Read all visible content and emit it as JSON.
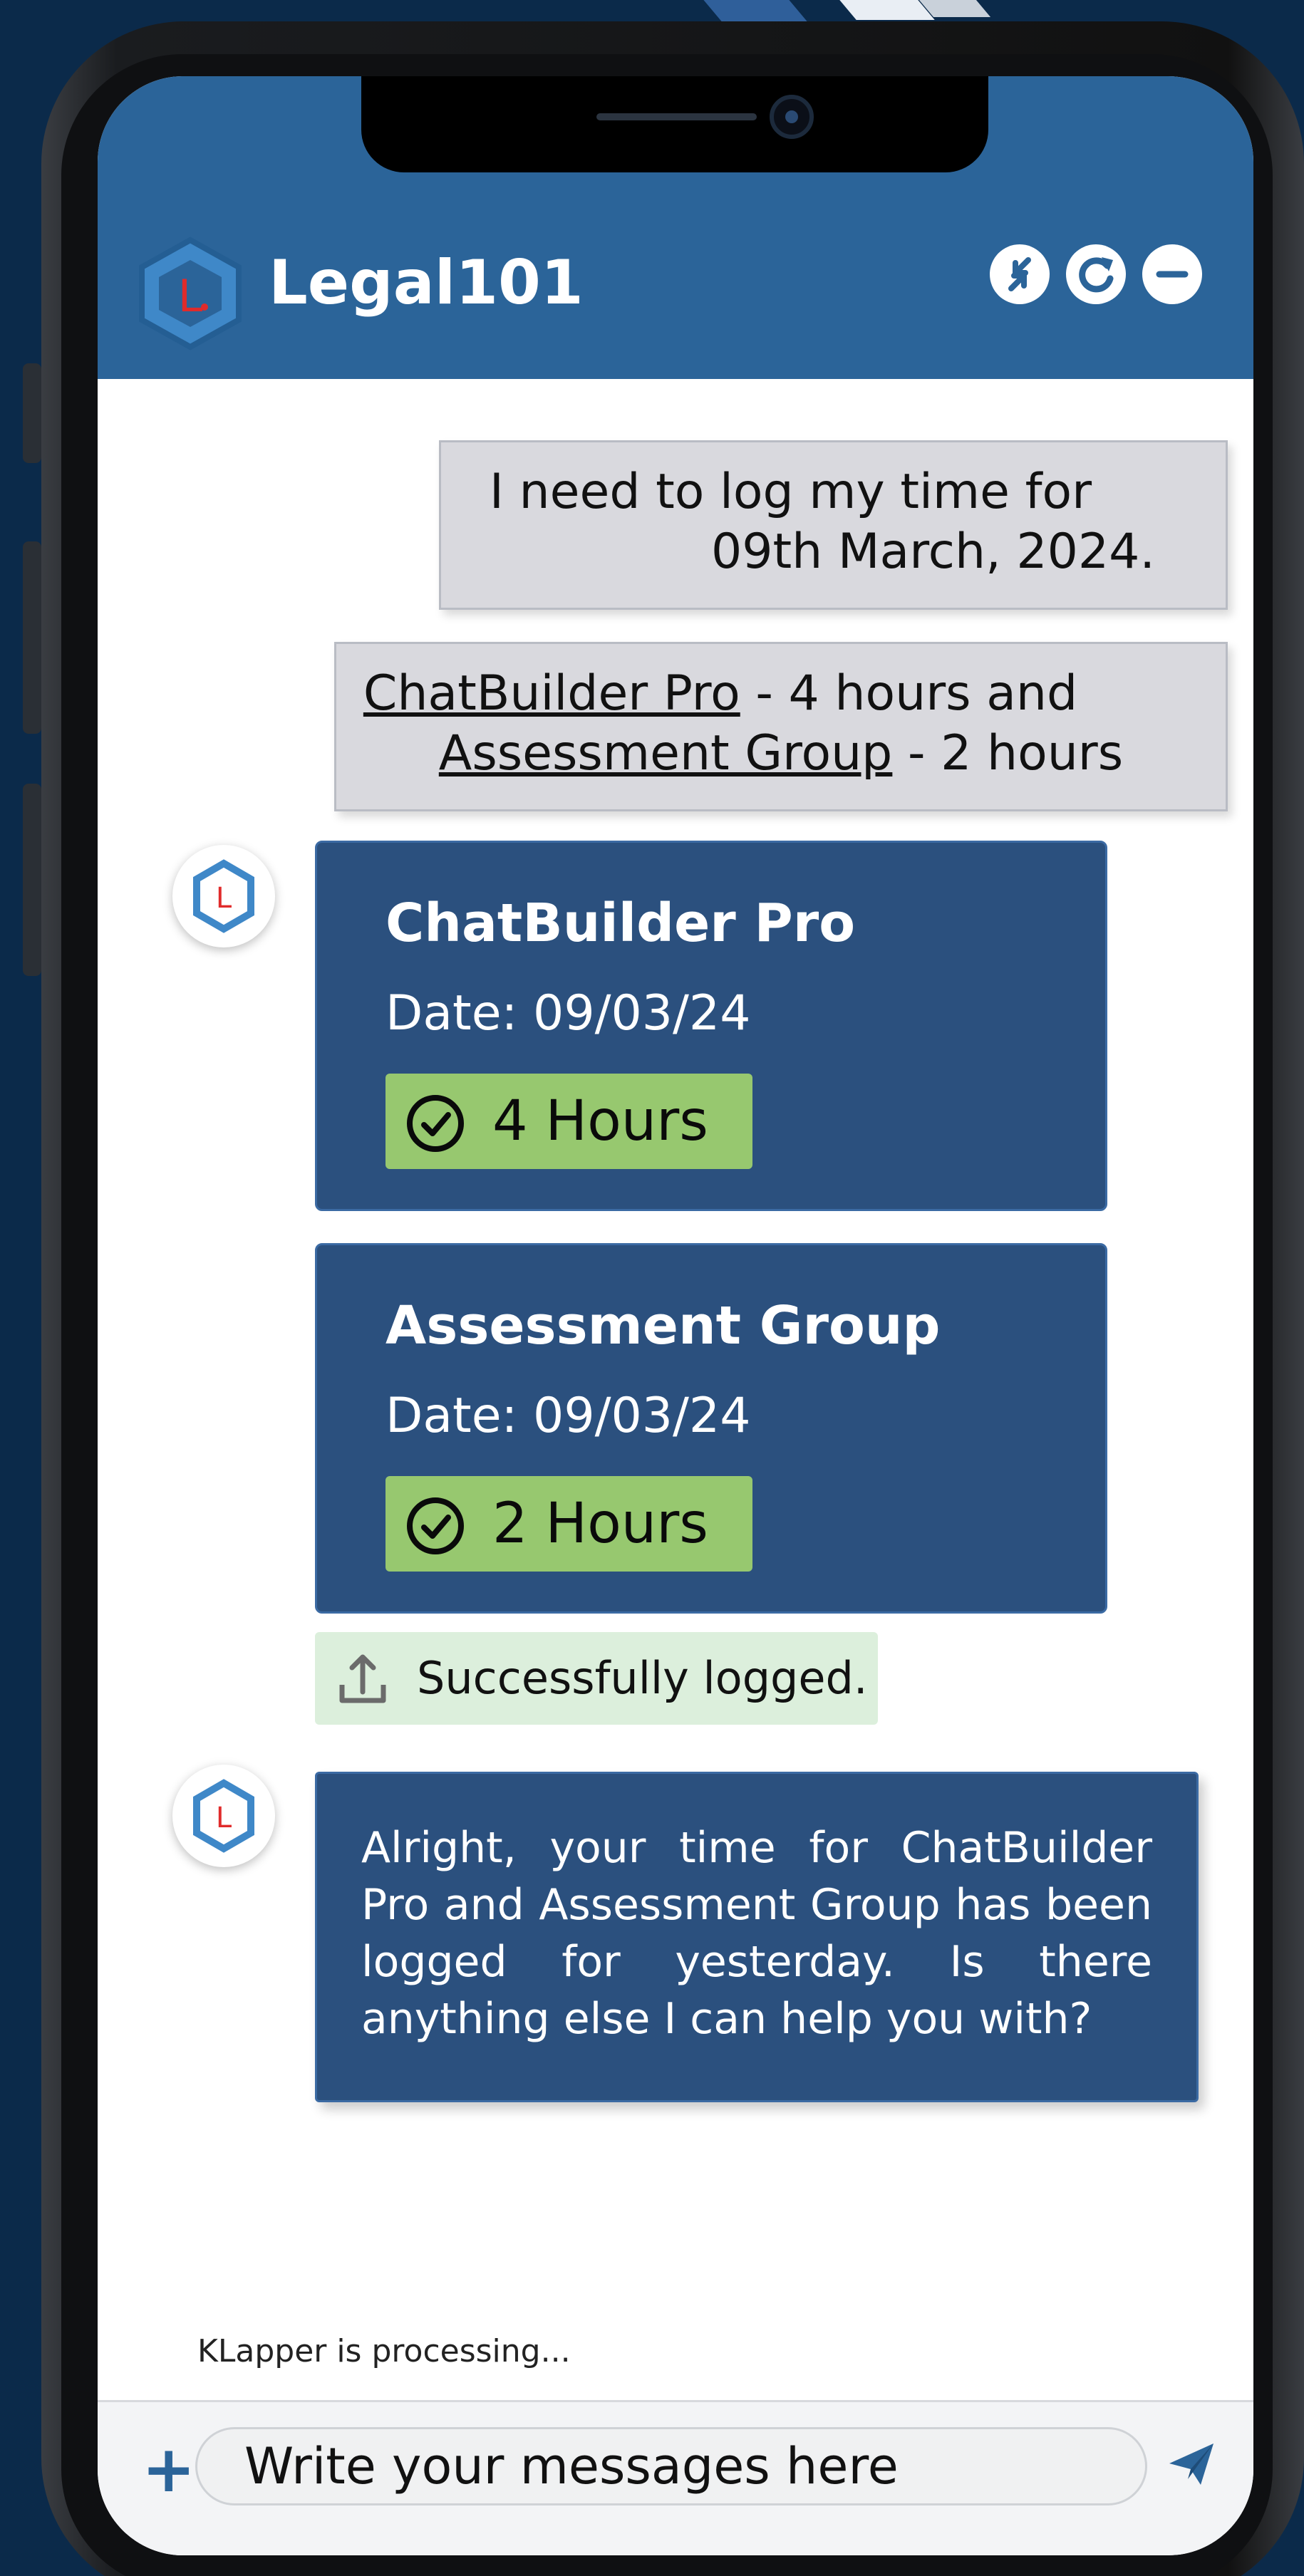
{
  "app": {
    "title": "Legal101",
    "logo_letter": "L",
    "header_buttons": [
      {
        "icon": "compress-icon"
      },
      {
        "icon": "refresh-icon"
      },
      {
        "icon": "minimize-icon"
      }
    ]
  },
  "conversation": {
    "user_msg_1": {
      "line1": "I need to log my time for",
      "line2": "09th March, 2024."
    },
    "user_msg_2": {
      "project1": "ChatBuilder Pro",
      "project1_suffix": " - 4 hours and",
      "project2": "Assessment Group",
      "project2_suffix": " - 2 hours"
    },
    "entries": [
      {
        "project": "ChatBuilder Pro",
        "date": "Date: 09/03/24",
        "hours": "4 Hours"
      },
      {
        "project": "Assessment Group",
        "date": "Date: 09/03/24",
        "hours": "2 Hours"
      }
    ],
    "status": "Successfully logged.",
    "bot_reply": "Alright, your time for ChatBuilder Pro and Assessment Group  has been logged for yesterday. Is there anything else I can help you with?"
  },
  "footer": {
    "processing": "KLapper is processing...",
    "input_placeholder": "Write your messages here",
    "plus_label": "+"
  },
  "colors": {
    "header": "#2b6499",
    "card": "#2b507e",
    "badge": "#97c86f",
    "status_bg": "#dcefdc",
    "user_bubble": "#d9d9de"
  }
}
